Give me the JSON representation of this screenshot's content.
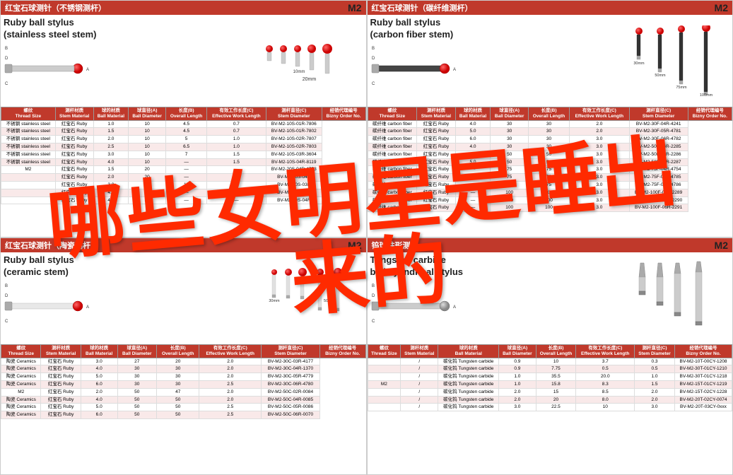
{
  "panels": [
    {
      "id": "panel-tl",
      "header": "红宝石球测针（不锈钢测杆）",
      "m2": "M2",
      "title_line1": "Ruby ball stylus",
      "title_line2": "(stainless steel stem)",
      "dim_label1": "10mm",
      "dim_label2": "20mm",
      "table": {
        "headers": [
          "螺纹\nThread Size",
          "测杆材质\nStem Material",
          "球的材质\nBall Material",
          "球直径(A)\nBall Diameter",
          "长度(B)\nOverall Length",
          "有效工作长度(C)\nEffective Work Length",
          "测杆直径(C)\nStem Diameter",
          "经销代理编号\nBizny Order No."
        ],
        "rows": [
          [
            "不锈钢 stainless steel",
            "红宝石 Ruby",
            "1.0",
            "10",
            "4.5",
            "0.7",
            "BV-M2-10S-01R-7806"
          ],
          [
            "不锈钢 stainless steel",
            "红宝石 Ruby",
            "1.5",
            "10",
            "4.5",
            "0.7",
            "BV-M2-10S-01R-7802"
          ],
          [
            "不锈钢 stainless steel",
            "红宝石 Ruby",
            "2.0",
            "10",
            "5",
            "1.0",
            "BV-M2-10S-02R-7807"
          ],
          [
            "不锈钢 stainless steel",
            "红宝石 Ruby",
            "2.5",
            "10",
            "6.5",
            "1.0",
            "BV-M2-10S-02R-7803"
          ],
          [
            "不锈钢 stainless steel",
            "红宝石 Ruby",
            "3.0",
            "10",
            "7",
            "1.5",
            "BV-M2-10S-03R-3604"
          ],
          [
            "不锈钢 stainless steel",
            "红宝石 Ruby",
            "4.0",
            "10",
            "—",
            "1.5",
            "BV-M2-10S-04R-8119"
          ],
          [
            "M2",
            "红宝石 Ruby",
            "1.5",
            "20",
            "—",
            "—",
            "BV-M2-20S-04R-4753"
          ],
          [
            "",
            "红宝石 Ruby",
            "2.0",
            "20",
            "—",
            "—",
            "BV-M2-20S-04R"
          ],
          [
            "",
            "红宝石 Ruby",
            "3.0",
            "20",
            "17",
            "—",
            "BV-M2-20S-03R"
          ],
          [
            "",
            "红宝石 Ruby",
            "4.0",
            "20",
            "—",
            "—",
            "BV-M2-20S-04R"
          ],
          [
            "",
            "红宝石 Ruby",
            "4.0",
            "30",
            "—",
            "—",
            "BV-M2-30S-04R"
          ]
        ]
      }
    },
    {
      "id": "panel-tr",
      "header": "红宝石球测针（碳纤维测杆）",
      "m2": "M2",
      "title_line1": "Ruby ball stylus",
      "title_line2": "(carbon fiber stem)",
      "dim_label1": "30mm",
      "dim_label2": "50mm",
      "dim_label3": "75mm",
      "dim_label4": "100mm",
      "table": {
        "headers": [
          "螺纹\nThread Size",
          "测杆材质\nStem Material",
          "球的材质\nBall Material",
          "球直径(A)\nBall Diameter",
          "长度(B)\nOverall Length",
          "有效工作长度(C)\nEffective Work Length",
          "测杆直径(C)\nStem Diameter",
          "经销代理编号\nBizny Order No."
        ],
        "rows": [
          [
            "碳纤维 carbon fiber",
            "红宝石 Ruby",
            "4.0",
            "30",
            "30",
            "2.0",
            "BV-M2-30F-04R-4241"
          ],
          [
            "碳纤维 carbon fiber",
            "红宝石 Ruby",
            "5.0",
            "30",
            "30",
            "2.0",
            "BV-M2-30F-05R-4781"
          ],
          [
            "碳纤维 carbon fiber",
            "红宝石 Ruby",
            "6.0",
            "30",
            "30",
            "3.0",
            "BV-M2-30F-06R-4782"
          ],
          [
            "碳纤维 carbon fiber",
            "红宝石 Ruby",
            "4.0",
            "30",
            "30",
            "3.0",
            "BV-M2-50F-04R-2285"
          ],
          [
            "碳纤维 carbon fiber",
            "红宝石 Ruby",
            "5.0",
            "50",
            "50",
            "3.0",
            "BV-M2-50F-05R-2286"
          ],
          [
            "碳纤维 carbon fiber",
            "红宝石 Ruby",
            "5.0",
            "50",
            "50",
            "3.0",
            "BV-M2-50F-06R-2287"
          ],
          [
            "碳纤维 carbon fiber",
            "红宝石 Ruby",
            "—",
            "75",
            "75",
            "3.0",
            "BV-M2-75F-04R-4754"
          ],
          [
            "碳纤维 carbon fiber",
            "红宝石 Ruby",
            "—",
            "75",
            "75",
            "3.0",
            "BV-M2-75F-05R-4785"
          ],
          [
            "碳纤维 carbon fiber",
            "红宝石 Ruby",
            "—",
            "75",
            "75",
            "3.0",
            "BV-M2-75F-05R-4786"
          ],
          [
            "碳纤维 carbon fiber",
            "红宝石 Ruby",
            "—",
            "100",
            "100",
            "3.0",
            "BV-M2-100F-06R-2289"
          ],
          [
            "碳纤维 carbon fiber",
            "红宝石 Ruby",
            "—",
            "100",
            "100",
            "3.0",
            "BV-M2-100F-06R-2290"
          ],
          [
            "碳纤维 carbon fiber",
            "红宝石 Ruby",
            "—",
            "100",
            "100",
            "3.0",
            "BV-M2-100F-06R-2291"
          ]
        ]
      }
    },
    {
      "id": "panel-bl",
      "header": "红宝石球测针（陶瓷测杆）",
      "m2": "M2",
      "title_line1": "Ruby ball stylus",
      "title_line2": "(ceramic stem)",
      "dim_label1": "30mm",
      "dim_label2": "50mm",
      "table": {
        "headers": [
          "螺纹\nThread Size",
          "测杆材质\nStem Material",
          "球的材质\nBall Material",
          "球直径(A)\nBall Diameter",
          "长度(B)\nOverall Length",
          "有效工作长度(C)\nEffective Work Length",
          "测杆直径(C)\nStem Diameter",
          "经销代理编号\nBizny Order No."
        ],
        "rows": [
          [
            "陶瓷 Ceramics",
            "红宝石 Ruby",
            "3.0",
            "27",
            "20",
            "2.0",
            "BV-M2-30C-03R-4177"
          ],
          [
            "陶瓷 Ceramics",
            "红宝石 Ruby",
            "4.0",
            "30",
            "30",
            "2.0",
            "BV-M2-30C-04R-1370"
          ],
          [
            "陶瓷 Ceramics",
            "红宝石 Ruby",
            "5.0",
            "30",
            "30",
            "2.0",
            "BV-M2-30C-05R-4779"
          ],
          [
            "陶瓷 Ceramics",
            "红宝石 Ruby",
            "6.0",
            "30",
            "30",
            "2.5",
            "BV-M2-30C-06R-4780"
          ],
          [
            "M2",
            "红宝石 Ruby",
            "2.0",
            "50",
            "47",
            "2.0",
            "BV-M2-50C-02R-0084"
          ],
          [
            "陶瓷 Ceramics",
            "红宝石 Ruby",
            "4.0",
            "50",
            "50",
            "2.0",
            "BV-M2-50C-04R-0085"
          ],
          [
            "陶瓷 Ceramics",
            "红宝石 Ruby",
            "5.0",
            "50",
            "50",
            "2.5",
            "BV-M2-50C-05R-0086"
          ],
          [
            "陶瓷 Ceramics",
            "红宝石 Ruby",
            "6.0",
            "50",
            "50",
            "2.5",
            "BV-M2-50C-06R-0070"
          ]
        ]
      }
    },
    {
      "id": "panel-br",
      "header": "钨球柱形测针",
      "m2": "M2",
      "title_line1": "Tungsten carbide",
      "title_line2": "ball cylindrical stylus",
      "table": {
        "headers": [
          "螺纹\nThread Size",
          "测杆材质\nStem Material",
          "球的材质\nBall Material",
          "球直径(A)\nBall Diameter",
          "长度(B)\nOverall Length",
          "有效工作长度(C)\nEffective Work Length",
          "测杆直径(C)\nStem Diameter",
          "经销代理编号\nBizny Order No."
        ],
        "rows": [
          [
            "",
            "/",
            "碳化钨 Tungsten carbide",
            "0.9",
            "10",
            "3.7",
            "0.3",
            "BV-M2-10T-00CY-1208"
          ],
          [
            "",
            "/",
            "碳化钨 Tungsten carbide",
            "0.9",
            "7.75",
            "0.5",
            "0.5",
            "BV-M2-30T-01CY-1210"
          ],
          [
            "",
            "/",
            "碳化钨 Tungsten carbide",
            "1.0",
            "35.5",
            "20.0",
            "1.0",
            "BV-M2-30T-01CY-1218"
          ],
          [
            "M2",
            "/",
            "碳化钨 Tungsten carbide",
            "1.0",
            "15.8",
            "8.3",
            "1.5",
            "BV-M2-15T-01CY-1219"
          ],
          [
            "",
            "/",
            "碳化钨 Tungsten carbide",
            "2.0",
            "15",
            "8.5",
            "2.0",
            "BV-M2-15T-02CY-1228"
          ],
          [
            "",
            "/",
            "碳化钨 Tungsten carbide",
            "2.0",
            "20",
            "8.0",
            "2.0",
            "BV-M2-20T-02CY-0074"
          ],
          [
            "",
            "/",
            "碳化钨 Tungsten carbide",
            "3.0",
            "22.5",
            "10",
            "3.0",
            "BV-M2-20T-03CY-0xxx"
          ]
        ]
      }
    }
  ],
  "watermark": {
    "line1": "哪些女明星是睡出",
    "line2": "来的"
  }
}
